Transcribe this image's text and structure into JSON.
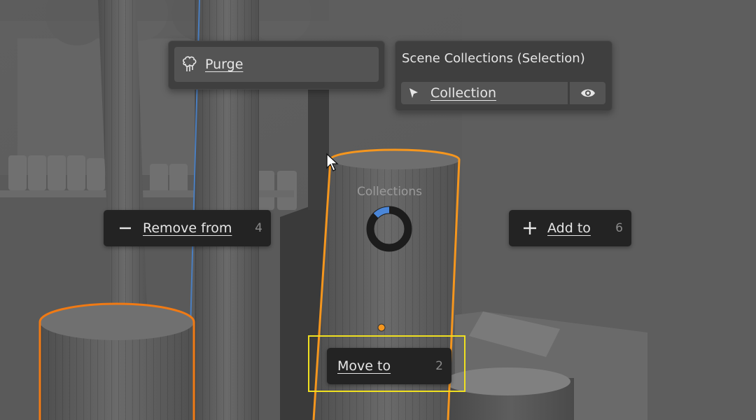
{
  "purge_menu": {
    "label": "Purge",
    "icon": "purge-icon"
  },
  "scene_collections": {
    "title": "Scene Collections (Selection)",
    "item_label": "Collection",
    "item_icon": "cursor-arrow-icon",
    "visibility_icon": "eye-icon"
  },
  "pie_menu": {
    "title": "Collections",
    "remove": {
      "label": "Remove from",
      "hotkey": "4",
      "icon": "minus-icon"
    },
    "add": {
      "label": "Add to",
      "hotkey": "6",
      "icon": "plus-icon"
    },
    "move": {
      "label": "Move to",
      "hotkey": "2"
    }
  },
  "colors": {
    "selection_orange": "#f5961e",
    "active_outline": "#f07a14",
    "highlight_yellow": "#f0e020",
    "pie_blue": "#4a86d8"
  }
}
